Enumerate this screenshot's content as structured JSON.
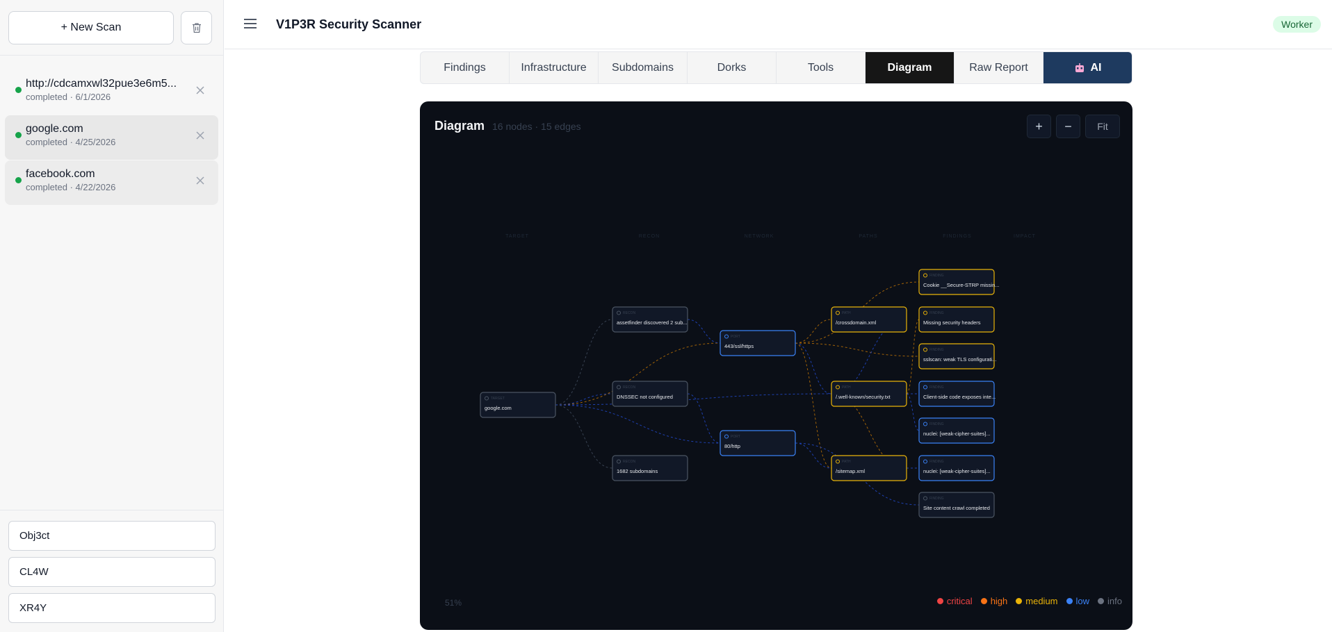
{
  "sidebar": {
    "new_scan_label": "+  New Scan",
    "scans": [
      {
        "name": "http://cdcamxwl32pue3e6m5...",
        "meta": "completed · 6/1/2026"
      },
      {
        "name": "google.com",
        "meta": "completed · 4/25/2026"
      },
      {
        "name": "facebook.com",
        "meta": "completed · 4/22/2026"
      }
    ],
    "bottom_fields": [
      "Obj3ct",
      "CL4W",
      "XR4Y"
    ]
  },
  "header": {
    "title": "V1P3R Security Scanner",
    "badge": "Worker"
  },
  "tabs": [
    "Findings",
    "Infrastructure",
    "Subdomains",
    "Dorks",
    "Tools",
    "Diagram",
    "Raw Report",
    "AI"
  ],
  "diagram": {
    "title": "Diagram",
    "stats": "16 nodes · 15 edges",
    "zoom_in": "+",
    "zoom_out": "−",
    "fit": "Fit",
    "zoom_level": "51%",
    "columns": [
      "TARGET",
      "RECON",
      "NETWORK",
      "PATHS",
      "FINDINGS",
      "IMPACT"
    ],
    "legend": [
      {
        "label": "critical",
        "color": "#ef4444"
      },
      {
        "label": "high",
        "color": "#f97316"
      },
      {
        "label": "medium",
        "color": "#eab308"
      },
      {
        "label": "low",
        "color": "#3b82f6"
      },
      {
        "label": "info",
        "color": "#6b7280"
      }
    ],
    "nodes": [
      {
        "id": "target",
        "kind": "TARGET",
        "label": "google.com",
        "tone": "gray"
      },
      {
        "id": "r1",
        "kind": "RECON",
        "label": "assetfinder discovered 2 sub...",
        "tone": "gray"
      },
      {
        "id": "r2",
        "kind": "RECON",
        "label": "DNSSEC not configured",
        "tone": "gray"
      },
      {
        "id": "r3",
        "kind": "RECON",
        "label": "1682 subdomains",
        "tone": "gray"
      },
      {
        "id": "p443",
        "kind": "PORT",
        "label": "443/ssl/https",
        "tone": "blue"
      },
      {
        "id": "p80",
        "kind": "PORT",
        "label": "80/http",
        "tone": "blue"
      },
      {
        "id": "path1",
        "kind": "PATH",
        "label": "/crossdomain.xml",
        "tone": "yellow"
      },
      {
        "id": "path2",
        "kind": "PATH",
        "label": "/.well-known/security.txt",
        "tone": "yellow"
      },
      {
        "id": "path3",
        "kind": "PATH",
        "label": "/sitemap.xml",
        "tone": "yellow"
      },
      {
        "id": "f1",
        "kind": "FINDING",
        "label": "Cookie __Secure-STRP missin...",
        "tone": "yellow"
      },
      {
        "id": "f2",
        "kind": "FINDING",
        "label": "Missing security headers",
        "tone": "yellow"
      },
      {
        "id": "f3",
        "kind": "FINDING",
        "label": "sslscan: weak TLS configurati...",
        "tone": "yellow"
      },
      {
        "id": "f4",
        "kind": "FINDING",
        "label": "Client-side code exposes inte...",
        "tone": "blue"
      },
      {
        "id": "f5",
        "kind": "FINDING",
        "label": "nuclei: [weak-cipher-suites]...",
        "tone": "blue"
      },
      {
        "id": "f6",
        "kind": "FINDING",
        "label": "nuclei: [weak-cipher-suites]...",
        "tone": "blue"
      },
      {
        "id": "f7",
        "kind": "FINDING",
        "label": "Site content crawl completed",
        "tone": "gray"
      }
    ],
    "edges": [
      [
        "target",
        "r1",
        "gray"
      ],
      [
        "target",
        "r2",
        "blue"
      ],
      [
        "target",
        "r3",
        "gray"
      ],
      [
        "target",
        "p443",
        "yellow"
      ],
      [
        "target",
        "p80",
        "blue"
      ],
      [
        "target",
        "path2",
        "blue"
      ],
      [
        "r1",
        "p443",
        "blue"
      ],
      [
        "r2",
        "p80",
        "blue"
      ],
      [
        "p443",
        "path1",
        "yellow"
      ],
      [
        "p443",
        "f1",
        "yellow"
      ],
      [
        "p443",
        "f3",
        "yellow"
      ],
      [
        "p443",
        "path2",
        "blue"
      ],
      [
        "p443",
        "path3",
        "yellow"
      ],
      [
        "p80",
        "path3",
        "blue"
      ],
      [
        "p80",
        "f7",
        "blue"
      ],
      [
        "path2",
        "f2",
        "yellow"
      ],
      [
        "path2",
        "f4",
        "blue"
      ],
      [
        "path2",
        "f5",
        "blue"
      ],
      [
        "path3",
        "f6",
        "blue"
      ],
      [
        "path1",
        "path2",
        "blue"
      ],
      [
        "path3",
        "path2",
        "yellow"
      ]
    ]
  }
}
